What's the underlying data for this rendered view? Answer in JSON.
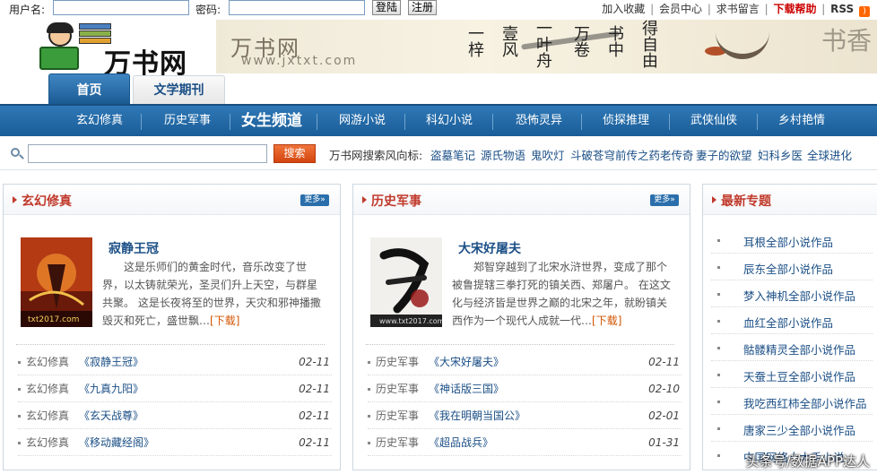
{
  "login": {
    "username_label": "用户名:",
    "password_label": "密码:",
    "login_button": "登陆",
    "register_button": "注册"
  },
  "toplinks": {
    "favorite": "加入收藏",
    "member": "会员中心",
    "message": "求书留言",
    "help": "下载帮助",
    "rss": "RSS"
  },
  "header": {
    "logo_text": "万书网",
    "banner_logo": "万书网",
    "banner_url": "www.jxtxt.com",
    "slogan": [
      "一梓",
      "壹风",
      "一叶舟",
      "万卷",
      "书中",
      "得自由"
    ],
    "banner_mark": "书香"
  },
  "tabs": [
    {
      "label": "首页",
      "active": true
    },
    {
      "label": "文学期刊",
      "active": false
    }
  ],
  "nav": [
    "玄幻修真",
    "历史军事",
    "女生频道",
    "网游小说",
    "科幻小说",
    "恐怖灵异",
    "侦探推理",
    "武侠仙侠",
    "乡村艳情"
  ],
  "search": {
    "button": "搜索",
    "trend_label": "万书网搜索风向标:",
    "trends": [
      "盗墓笔记",
      "源氏物语",
      "鬼吹灯",
      "斗破苍穹前传之药老传奇",
      "妻子的欲望",
      "妇科乡医",
      "全球进化"
    ]
  },
  "panels": [
    {
      "title": "玄幻修真",
      "more": "更多»",
      "book_title": "寂静王冠",
      "desc": "这是乐师们的黄金时代，音乐改变了世界，以太铸就荣光，圣灵们升上天空，与群星共聚。 这是长夜将至的世界，天灾和邪神播撒毁灭和死亡，盛世飘…",
      "download": "[下载]",
      "rows": [
        {
          "cat": "玄幻修真",
          "name": "《寂静王冠》",
          "date": "02-11"
        },
        {
          "cat": "玄幻修真",
          "name": "《九真九阳》",
          "date": "02-11"
        },
        {
          "cat": "玄幻修真",
          "name": "《玄天战尊》",
          "date": "02-11"
        },
        {
          "cat": "玄幻修真",
          "name": "《移动藏经阁》",
          "date": "02-11"
        }
      ]
    },
    {
      "title": "历史军事",
      "more": "更多»",
      "book_title": "大宋好屠夫",
      "desc": "郑智穿越到了北宋水浒世界，变成了那个被鲁提辖三拳打死的镇关西、郑屠户。 在这文化与经济皆是世界之巅的北宋之年，就盼镇关西作为一个现代人成就一代…",
      "download": "[下载]",
      "rows": [
        {
          "cat": "历史军事",
          "name": "《大宋好屠夫》",
          "date": "02-11"
        },
        {
          "cat": "历史军事",
          "name": "《神话版三国》",
          "date": "02-10"
        },
        {
          "cat": "历史军事",
          "name": "《我在明朝当国公》",
          "date": "02-01"
        },
        {
          "cat": "历史军事",
          "name": "《超品战兵》",
          "date": "01-31"
        }
      ]
    }
  ],
  "topics": {
    "title": "最新专题",
    "items": [
      "耳根全部小说作品",
      "辰东全部小说作品",
      "梦入神机全部小说作品",
      "血红全部小说作品",
      "骷髅精灵全部小说作品",
      "天蚕土豆全部小说作品",
      "我吃西红柿全部小说作品",
      "唐家三少全部小说作品",
      "中国网络十大手小说"
    ]
  },
  "watermark": "头条号/数据APP达人"
}
